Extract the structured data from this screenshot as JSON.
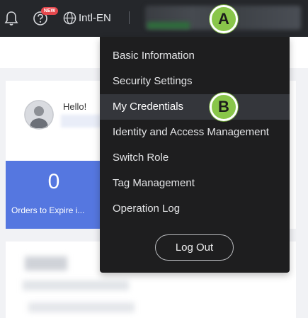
{
  "topbar": {
    "new_badge": "NEW",
    "language": "Intl-EN"
  },
  "dashboard": {
    "greeting": "Hello!",
    "stat_value": "0",
    "stat_label": "Orders to Expire i..."
  },
  "account_menu": {
    "items": [
      {
        "label": "Basic Information"
      },
      {
        "label": "Security Settings"
      },
      {
        "label": "My Credentials"
      },
      {
        "label": "Identity and Access Management"
      },
      {
        "label": "Switch Role"
      },
      {
        "label": "Tag Management"
      },
      {
        "label": "Operation Log"
      }
    ],
    "logout_label": "Log Out",
    "active_item": "My Credentials"
  },
  "markers": {
    "a": "A",
    "b": "B"
  },
  "colors": {
    "topbar_bg": "#25272b",
    "menu_bg": "#1e1e1f",
    "stat_blue": "#5577e0",
    "marker_green": "#89c64a"
  }
}
